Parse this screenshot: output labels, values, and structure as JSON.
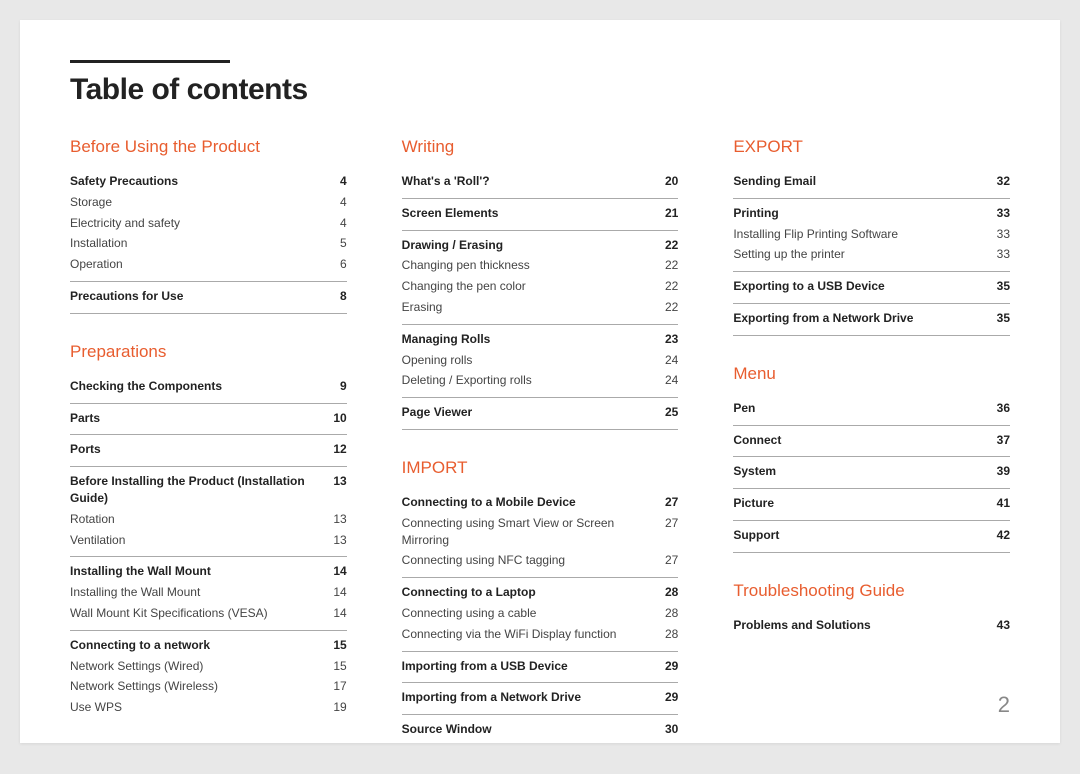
{
  "title": "Table of contents",
  "page_number": "2",
  "columns": [
    {
      "sections": [
        {
          "heading": "Before Using the Product",
          "groups": [
            {
              "entries": [
                {
                  "label": "Safety Precautions",
                  "page": "4",
                  "bold": true
                },
                {
                  "label": "Storage",
                  "page": "4"
                },
                {
                  "label": "Electricity and safety",
                  "page": "4"
                },
                {
                  "label": "Installation",
                  "page": "5"
                },
                {
                  "label": "Operation",
                  "page": "6"
                }
              ]
            },
            {
              "entries": [
                {
                  "label": "Precautions for Use",
                  "page": "8",
                  "bold": true
                }
              ]
            }
          ]
        },
        {
          "heading": "Preparations",
          "groups": [
            {
              "entries": [
                {
                  "label": "Checking the Components",
                  "page": "9",
                  "bold": true
                }
              ]
            },
            {
              "entries": [
                {
                  "label": "Parts",
                  "page": "10",
                  "bold": true
                }
              ]
            },
            {
              "entries": [
                {
                  "label": "Ports",
                  "page": "12",
                  "bold": true
                }
              ]
            },
            {
              "entries": [
                {
                  "label": "Before Installing the Product (Installation Guide)",
                  "page": "13",
                  "bold": true
                },
                {
                  "label": "Rotation",
                  "page": "13"
                },
                {
                  "label": "Ventilation",
                  "page": "13"
                }
              ]
            },
            {
              "entries": [
                {
                  "label": "Installing the Wall Mount",
                  "page": "14",
                  "bold": true
                },
                {
                  "label": "Installing the Wall Mount",
                  "page": "14"
                },
                {
                  "label": "Wall Mount Kit Specifications (VESA)",
                  "page": "14"
                }
              ]
            },
            {
              "entries": [
                {
                  "label": "Connecting to a network",
                  "page": "15",
                  "bold": true
                },
                {
                  "label": "Network Settings (Wired)",
                  "page": "15"
                },
                {
                  "label": "Network Settings (Wireless)",
                  "page": "17"
                },
                {
                  "label": "Use WPS",
                  "page": "19"
                }
              ],
              "noborder": true
            }
          ]
        }
      ]
    },
    {
      "sections": [
        {
          "heading": "Writing",
          "groups": [
            {
              "entries": [
                {
                  "label": "What's a 'Roll'?",
                  "page": "20",
                  "bold": true
                }
              ]
            },
            {
              "entries": [
                {
                  "label": "Screen Elements",
                  "page": "21",
                  "bold": true
                }
              ]
            },
            {
              "entries": [
                {
                  "label": "Drawing / Erasing",
                  "page": "22",
                  "bold": true
                },
                {
                  "label": "Changing pen thickness",
                  "page": "22"
                },
                {
                  "label": "Changing the pen color",
                  "page": "22"
                },
                {
                  "label": "Erasing",
                  "page": "22"
                }
              ]
            },
            {
              "entries": [
                {
                  "label": "Managing Rolls",
                  "page": "23",
                  "bold": true
                },
                {
                  "label": "Opening rolls",
                  "page": "24"
                },
                {
                  "label": "Deleting / Exporting rolls",
                  "page": "24"
                }
              ]
            },
            {
              "entries": [
                {
                  "label": "Page Viewer",
                  "page": "25",
                  "bold": true
                }
              ]
            }
          ]
        },
        {
          "heading": "IMPORT",
          "groups": [
            {
              "entries": [
                {
                  "label": "Connecting to a Mobile Device",
                  "page": "27",
                  "bold": true
                },
                {
                  "label": "Connecting using Smart View or Screen Mirroring",
                  "page": "27"
                },
                {
                  "label": "Connecting using NFC tagging",
                  "page": "27"
                }
              ]
            },
            {
              "entries": [
                {
                  "label": "Connecting to a Laptop",
                  "page": "28",
                  "bold": true
                },
                {
                  "label": "Connecting using a cable",
                  "page": "28"
                },
                {
                  "label": "Connecting via the WiFi Display function",
                  "page": "28"
                }
              ]
            },
            {
              "entries": [
                {
                  "label": "Importing from a USB Device",
                  "page": "29",
                  "bold": true
                }
              ]
            },
            {
              "entries": [
                {
                  "label": "Importing from a Network Drive",
                  "page": "29",
                  "bold": true
                }
              ]
            },
            {
              "entries": [
                {
                  "label": "Source Window",
                  "page": "30",
                  "bold": true
                }
              ],
              "noborder": true
            }
          ]
        }
      ]
    },
    {
      "sections": [
        {
          "heading": "EXPORT",
          "groups": [
            {
              "entries": [
                {
                  "label": "Sending Email",
                  "page": "32",
                  "bold": true
                }
              ]
            },
            {
              "entries": [
                {
                  "label": "Printing",
                  "page": "33",
                  "bold": true
                },
                {
                  "label": "Installing Flip Printing Software",
                  "page": "33"
                },
                {
                  "label": "Setting up the printer",
                  "page": "33"
                }
              ]
            },
            {
              "entries": [
                {
                  "label": "Exporting to a USB Device",
                  "page": "35",
                  "bold": true
                }
              ]
            },
            {
              "entries": [
                {
                  "label": "Exporting from a Network Drive",
                  "page": "35",
                  "bold": true
                }
              ]
            }
          ]
        },
        {
          "heading": "Menu",
          "groups": [
            {
              "entries": [
                {
                  "label": "Pen",
                  "page": "36",
                  "bold": true
                }
              ]
            },
            {
              "entries": [
                {
                  "label": "Connect",
                  "page": "37",
                  "bold": true
                }
              ]
            },
            {
              "entries": [
                {
                  "label": "System",
                  "page": "39",
                  "bold": true
                }
              ]
            },
            {
              "entries": [
                {
                  "label": "Picture",
                  "page": "41",
                  "bold": true
                }
              ]
            },
            {
              "entries": [
                {
                  "label": "Support",
                  "page": "42",
                  "bold": true
                }
              ]
            }
          ]
        },
        {
          "heading": "Troubleshooting Guide",
          "groups": [
            {
              "entries": [
                {
                  "label": "Problems and Solutions",
                  "page": "43",
                  "bold": true
                }
              ],
              "noborder": true
            }
          ]
        }
      ]
    }
  ]
}
